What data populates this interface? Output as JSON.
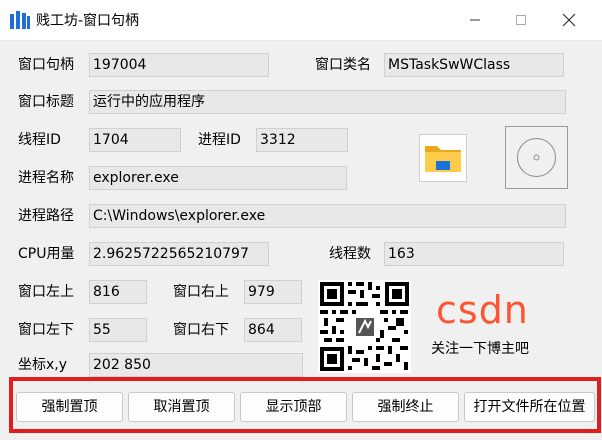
{
  "window": {
    "title": "贱工坊-窗口句柄"
  },
  "fields": {
    "hwnd": {
      "label": "窗口句柄",
      "value": "197004"
    },
    "class_name": {
      "label": "窗口类名",
      "value": "MSTaskSwWClass"
    },
    "window_title": {
      "label": "窗口标题",
      "value": "运行中的应用程序"
    },
    "thread_id": {
      "label": "线程ID",
      "value": "1704"
    },
    "process_id": {
      "label": "进程ID",
      "value": "3312"
    },
    "process_name": {
      "label": "进程名称",
      "value": "explorer.exe"
    },
    "process_path": {
      "label": "进程路径",
      "value": "C:\\Windows\\explorer.exe"
    },
    "cpu_usage": {
      "label": "CPU用量",
      "value": "2.9625722565210797"
    },
    "thread_count": {
      "label": "线程数",
      "value": "163"
    },
    "left_top": {
      "label": "窗口左上",
      "value": "816"
    },
    "right_top": {
      "label": "窗口右上",
      "value": "979"
    },
    "left_bottom": {
      "label": "窗口左下",
      "value": "55"
    },
    "right_bottom": {
      "label": "窗口右下",
      "value": "864"
    },
    "coords": {
      "label": "坐标x,y",
      "value": "202 850"
    }
  },
  "icons": {
    "process_icon": "folder-icon",
    "placeholder_icon": "disc-icon"
  },
  "promo": {
    "logo": "CSDN",
    "subtitle": "关注一下博主吧"
  },
  "buttons": {
    "force_top": "强制置顶",
    "cancel_top": "取消置顶",
    "show_top": "显示顶部",
    "force_kill": "强制终止",
    "open_location": "打开文件所在位置"
  },
  "colors": {
    "highlight_border": "#e11d1d",
    "csdn_brand": "#fc5531"
  }
}
